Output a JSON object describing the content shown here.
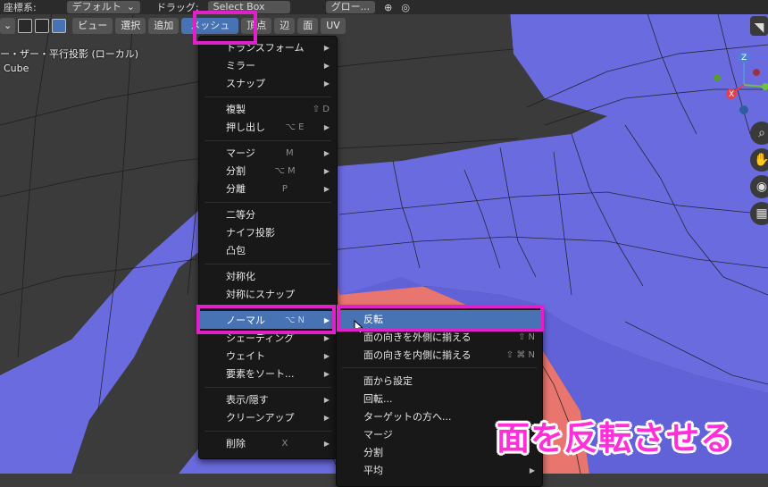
{
  "topbar": {
    "coord_label": "座標系:",
    "pivot_value": "デフォルト",
    "drag_label": "ドラッグ:",
    "drag_value": "Select Box",
    "transform_value": "グロー..."
  },
  "header": {
    "buttons": [
      "ビュー",
      "選択",
      "追加",
      "メッシュ",
      "頂点",
      "辺",
      "面",
      "UV"
    ],
    "active_button": "メッシュ"
  },
  "viewport": {
    "view_name": "ー・ザー・平行投影 (ローカル)",
    "object_name": "Cube"
  },
  "mesh_menu": {
    "items": [
      {
        "label": "トランスフォーム",
        "shortcut": "",
        "submenu": true
      },
      {
        "label": "ミラー",
        "shortcut": "",
        "submenu": true
      },
      {
        "label": "スナップ",
        "shortcut": "",
        "submenu": true
      },
      {
        "label": "複製",
        "shortcut": "⇧ D",
        "submenu": false
      },
      {
        "label": "押し出し",
        "shortcut": "⌥ E",
        "submenu": true
      },
      {
        "label": "マージ",
        "shortcut": "M",
        "submenu": true
      },
      {
        "label": "分割",
        "shortcut": "⌥ M",
        "submenu": true
      },
      {
        "label": "分離",
        "shortcut": "P",
        "submenu": true
      },
      {
        "label": "二等分",
        "shortcut": "",
        "submenu": false
      },
      {
        "label": "ナイフ投影",
        "shortcut": "",
        "submenu": false
      },
      {
        "label": "凸包",
        "shortcut": "",
        "submenu": false
      },
      {
        "label": "対称化",
        "shortcut": "",
        "submenu": false
      },
      {
        "label": "対称にスナップ",
        "shortcut": "",
        "submenu": false
      },
      {
        "label": "ノーマル",
        "shortcut": "⌥ N",
        "submenu": true
      },
      {
        "label": "シェーディング",
        "shortcut": "",
        "submenu": true
      },
      {
        "label": "ウェイト",
        "shortcut": "",
        "submenu": true
      },
      {
        "label": "要素をソート...",
        "shortcut": "",
        "submenu": true
      },
      {
        "label": "表示/隠す",
        "shortcut": "",
        "submenu": true
      },
      {
        "label": "クリーンアップ",
        "shortcut": "",
        "submenu": true
      },
      {
        "label": "削除",
        "shortcut": "X",
        "submenu": true
      }
    ]
  },
  "normal_submenu": {
    "items": [
      {
        "label": "反転",
        "shortcut": ""
      },
      {
        "label": "面の向きを外側に揃える",
        "shortcut": "⇧ N"
      },
      {
        "label": "面の向きを内側に揃える",
        "shortcut": "⇧ ⌘ N"
      },
      {
        "label": "面から設定",
        "shortcut": ""
      },
      {
        "label": "回転...",
        "shortcut": ""
      },
      {
        "label": "ターゲットの方へ...",
        "shortcut": ""
      },
      {
        "label": "マージ",
        "shortcut": ""
      },
      {
        "label": "分割",
        "shortcut": ""
      },
      {
        "label": "平均",
        "shortcut": ""
      }
    ]
  },
  "gizmo": {
    "z_label": "Z",
    "x_label": "X"
  },
  "caption": "面を反転させる",
  "colors": {
    "mesh_face": "#6b6be0",
    "mesh_back": "#e8766e",
    "menu_bg": "#181818",
    "highlight": "#4772b3",
    "annotation": "#e020c8"
  }
}
